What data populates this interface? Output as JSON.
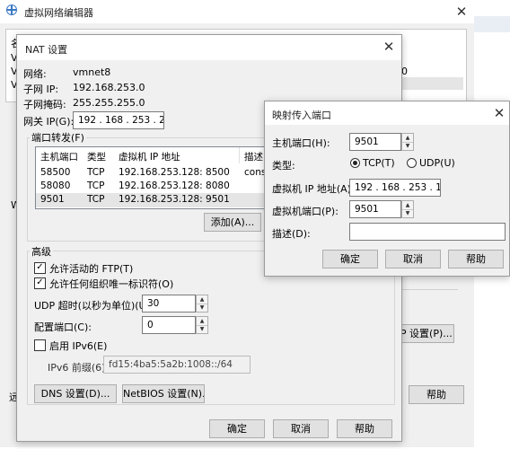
{
  "main_window": {
    "title": "虚拟网络编辑器",
    "close_icon": "close-icon",
    "bg_fragments": [
      "名",
      "V",
      "V",
      "V",
      "W",
      "",
      "",
      "",
      "",
      "",
      "",
      "",
      "远"
    ],
    "bg_values": [
      "0",
      ".0"
    ],
    "nat_settings_button": "CP 设置(P)...",
    "help_button": "帮助"
  },
  "nat_dialog": {
    "title": "NAT 设置",
    "network_label": "网络:",
    "network_value": "vmnet8",
    "subnet_ip_label": "子网 IP:",
    "subnet_ip_value": "192.168.253.0",
    "subnet_mask_label": "子网掩码:",
    "subnet_mask_value": "255.255.255.0",
    "gateway_label": "网关 IP(G):",
    "gateway_value": "192 . 168 . 253 .  2",
    "port_forwarding_label": "端口转发(F)",
    "port_table": {
      "headers": [
        "主机端口",
        "类型",
        "虚拟机 IP 地址",
        "描述"
      ],
      "rows": [
        [
          "58500",
          "TCP",
          "192.168.253.128: 8500",
          "consu"
        ],
        [
          "58080",
          "TCP",
          "192.168.253.128: 8080",
          ""
        ],
        [
          "9501",
          "TCP",
          "192.168.253.128: 9501",
          ""
        ]
      ]
    },
    "add_button": "添加(A)...",
    "advanced_label": "高级",
    "allow_ftp_label": "允许活动的 FTP(T)",
    "allow_ftp_checked": true,
    "allow_uid_label": "允许任何组织唯一标识符(O)",
    "allow_uid_checked": true,
    "udp_timeout_label": "UDP 超时(以秒为单位)(U):",
    "udp_timeout_value": "30",
    "config_port_label": "配置端口(C):",
    "config_port_value": "0",
    "enable_ipv6_label": "启用 IPv6(E)",
    "enable_ipv6_checked": false,
    "ipv6_prefix_label": "IPv6 前缀(6):",
    "ipv6_prefix_value": "fd15:4ba5:5a2b:1008::/64",
    "dns_button": "DNS 设置(D)...",
    "netbios_button": "NetBIOS 设置(N)...",
    "ok_button": "确定",
    "cancel_button": "取消",
    "help_button": "帮助"
  },
  "port_dialog": {
    "title": "映射传入端口",
    "host_port_label": "主机端口(H):",
    "host_port_value": "9501",
    "type_label": "类型:",
    "tcp_label": "TCP(T)",
    "udp_label": "UDP(U)",
    "selected_type": "TCP",
    "vm_ip_label": "虚拟机 IP 地址(A):",
    "vm_ip_value": "192 . 168 . 253 . 128",
    "vm_port_label": "虚拟机端口(P):",
    "vm_port_value": "9501",
    "description_label": "描述(D):",
    "description_value": "",
    "ok_button": "确定",
    "cancel_button": "取消",
    "help_button": "帮助"
  }
}
